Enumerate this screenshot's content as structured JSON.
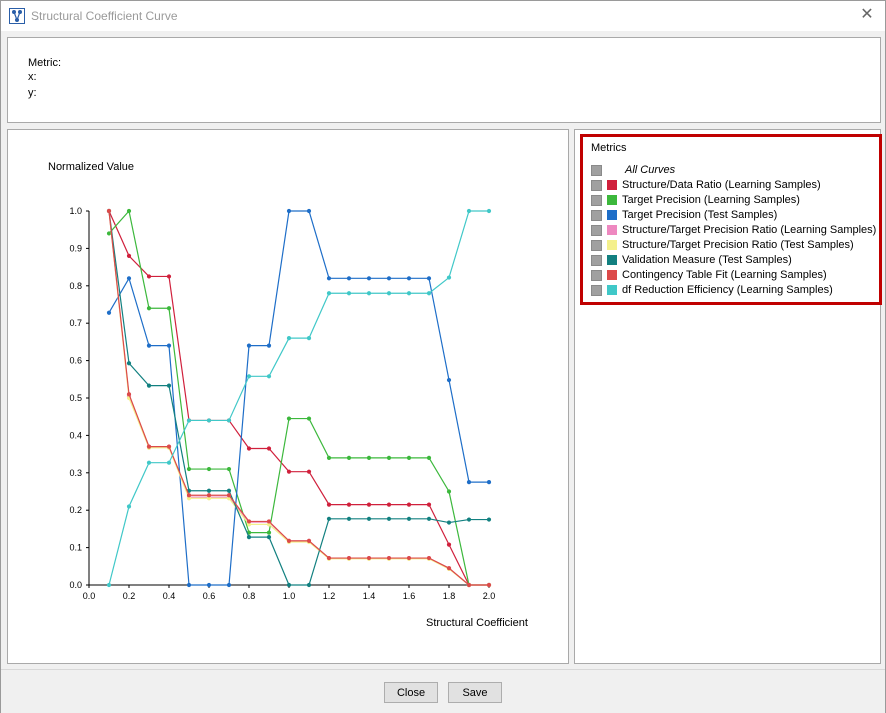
{
  "window": {
    "title": "Structural Coefficient Curve",
    "close_glyph": "✕"
  },
  "info": {
    "metric_label": "Metric:",
    "x_label": "x:",
    "y_label": "y:"
  },
  "chart_data": {
    "type": "line",
    "title": "",
    "xlabel": "Structural Coefficient",
    "ylabel": "Normalized Value",
    "xlim": [
      0.0,
      2.0
    ],
    "ylim": [
      0.0,
      1.0
    ],
    "x_ticks": [
      "0.0",
      "0.2",
      "0.4",
      "0.6",
      "0.8",
      "1.0",
      "1.2",
      "1.4",
      "1.6",
      "1.8",
      "2.0"
    ],
    "y_ticks": [
      "0.0",
      "0.1",
      "0.2",
      "0.3",
      "0.4",
      "0.5",
      "0.6",
      "0.7",
      "0.8",
      "0.9",
      "1.0"
    ],
    "grid": false,
    "x": [
      0.1,
      0.2,
      0.3,
      0.4,
      0.5,
      0.6,
      0.7,
      0.8,
      0.9,
      1.0,
      1.1,
      1.2,
      1.3,
      1.4,
      1.5,
      1.6,
      1.7,
      1.8,
      1.9,
      2.0
    ],
    "series": [
      {
        "name": "Structure/Data Ratio (Learning Samples)",
        "color": "#d0203c",
        "values": [
          1.0,
          0.88,
          0.825,
          0.825,
          0.44,
          0.44,
          0.44,
          0.365,
          0.365,
          0.303,
          0.303,
          0.215,
          0.215,
          0.215,
          0.215,
          0.215,
          0.215,
          0.108,
          0.0,
          0.0
        ]
      },
      {
        "name": "Target Precision (Learning Samples)",
        "color": "#3cb83c",
        "values": [
          0.94,
          1.0,
          0.74,
          0.74,
          0.31,
          0.31,
          0.31,
          0.14,
          0.14,
          0.445,
          0.445,
          0.34,
          0.34,
          0.34,
          0.34,
          0.34,
          0.34,
          0.25,
          0.0,
          0.0
        ]
      },
      {
        "name": "Target Precision (Test Samples)",
        "color": "#1e6ec8",
        "values": [
          0.728,
          0.82,
          0.64,
          0.64,
          0.0,
          0.0,
          0.0,
          0.64,
          0.64,
          1.0,
          1.0,
          0.82,
          0.82,
          0.82,
          0.82,
          0.82,
          0.82,
          0.548,
          0.275,
          0.275
        ]
      },
      {
        "name": "Structure/Target Precision Ratio (Learning Samples)",
        "color": "#ee88c0",
        "values": [
          1.0,
          0.505,
          0.37,
          0.37,
          0.235,
          0.235,
          0.235,
          0.168,
          0.168,
          0.118,
          0.118,
          0.072,
          0.072,
          0.072,
          0.072,
          0.072,
          0.072,
          0.045,
          0.0,
          0.0
        ]
      },
      {
        "name": "Structure/Target Precision Ratio (Test Samples)",
        "color": "#f4f08c",
        "values": [
          1.0,
          0.5,
          0.367,
          0.367,
          0.232,
          0.232,
          0.232,
          0.162,
          0.162,
          0.115,
          0.115,
          0.07,
          0.07,
          0.07,
          0.07,
          0.07,
          0.07,
          0.043,
          0.0,
          0.0
        ]
      },
      {
        "name": "Validation Measure (Test Samples)",
        "color": "#128080",
        "values": [
          1.0,
          0.593,
          0.533,
          0.533,
          0.252,
          0.252,
          0.252,
          0.128,
          0.128,
          0.0,
          0.0,
          0.177,
          0.177,
          0.177,
          0.177,
          0.177,
          0.177,
          0.167,
          0.175,
          0.175
        ]
      },
      {
        "name": "Contingency Table Fit (Learning Samples)",
        "color": "#dc4a4a",
        "values": [
          1.0,
          0.51,
          0.37,
          0.37,
          0.24,
          0.24,
          0.24,
          0.17,
          0.17,
          0.118,
          0.118,
          0.072,
          0.072,
          0.072,
          0.072,
          0.072,
          0.072,
          0.045,
          0.0,
          0.0
        ]
      },
      {
        "name": "df Reduction Efficiency (Learning Samples)",
        "color": "#40c8c8",
        "values": [
          0.0,
          0.21,
          0.327,
          0.327,
          0.44,
          0.44,
          0.44,
          0.558,
          0.558,
          0.66,
          0.66,
          0.78,
          0.78,
          0.78,
          0.78,
          0.78,
          0.78,
          0.822,
          1.0,
          1.0
        ]
      }
    ]
  },
  "legend": {
    "title": "Metrics",
    "all_curves_label": "All Curves",
    "items": [
      {
        "label": "Structure/Data Ratio (Learning Samples)",
        "color": "#d0203c"
      },
      {
        "label": "Target Precision (Learning Samples)",
        "color": "#3cb83c"
      },
      {
        "label": "Target Precision (Test Samples)",
        "color": "#1e6ec8"
      },
      {
        "label": "Structure/Target Precision Ratio (Learning Samples)",
        "color": "#ee88c0"
      },
      {
        "label": "Structure/Target Precision Ratio (Test Samples)",
        "color": "#f4f08c"
      },
      {
        "label": "Validation Measure (Test Samples)",
        "color": "#128080"
      },
      {
        "label": "Contingency Table Fit (Learning Samples)",
        "color": "#dc4a4a"
      },
      {
        "label": "df Reduction Efficiency (Learning Samples)",
        "color": "#40c8c8"
      }
    ]
  },
  "footer": {
    "close_label": "Close",
    "save_label": "Save"
  }
}
